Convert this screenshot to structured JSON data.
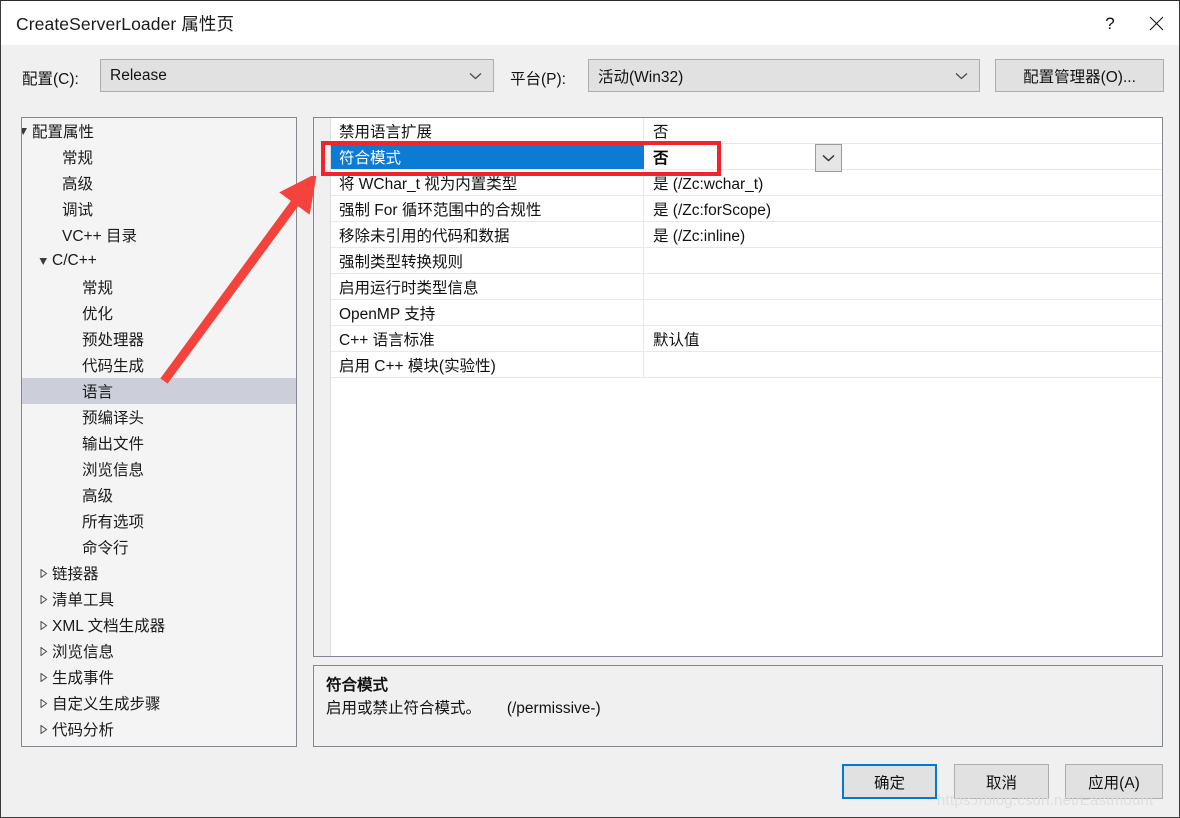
{
  "window": {
    "title": "CreateServerLoader 属性页",
    "help_icon": "?",
    "close_icon": "close-icon"
  },
  "config_bar": {
    "configuration_label": "配置(C):",
    "configuration_value": "Release",
    "platform_label": "平台(P):",
    "platform_value": "活动(Win32)",
    "config_manager_button": "配置管理器(O)..."
  },
  "tree": {
    "items": [
      {
        "label": "配置属性",
        "indent": 10,
        "twisty": "expanded",
        "selected": false
      },
      {
        "label": "常规",
        "indent": 40,
        "twisty": "none",
        "selected": false
      },
      {
        "label": "高级",
        "indent": 40,
        "twisty": "none",
        "selected": false
      },
      {
        "label": "调试",
        "indent": 40,
        "twisty": "none",
        "selected": false
      },
      {
        "label": "VC++ 目录",
        "indent": 40,
        "twisty": "none",
        "selected": false
      },
      {
        "label": "C/C++",
        "indent": 30,
        "twisty": "expanded",
        "selected": false
      },
      {
        "label": "常规",
        "indent": 60,
        "twisty": "none",
        "selected": false
      },
      {
        "label": "优化",
        "indent": 60,
        "twisty": "none",
        "selected": false
      },
      {
        "label": "预处理器",
        "indent": 60,
        "twisty": "none",
        "selected": false
      },
      {
        "label": "代码生成",
        "indent": 60,
        "twisty": "none",
        "selected": false
      },
      {
        "label": "语言",
        "indent": 60,
        "twisty": "none",
        "selected": true
      },
      {
        "label": "预编译头",
        "indent": 60,
        "twisty": "none",
        "selected": false
      },
      {
        "label": "输出文件",
        "indent": 60,
        "twisty": "none",
        "selected": false
      },
      {
        "label": "浏览信息",
        "indent": 60,
        "twisty": "none",
        "selected": false
      },
      {
        "label": "高级",
        "indent": 60,
        "twisty": "none",
        "selected": false
      },
      {
        "label": "所有选项",
        "indent": 60,
        "twisty": "none",
        "selected": false
      },
      {
        "label": "命令行",
        "indent": 60,
        "twisty": "none",
        "selected": false
      },
      {
        "label": "链接器",
        "indent": 30,
        "twisty": "collapsed",
        "selected": false
      },
      {
        "label": "清单工具",
        "indent": 30,
        "twisty": "collapsed",
        "selected": false
      },
      {
        "label": "XML 文档生成器",
        "indent": 30,
        "twisty": "collapsed",
        "selected": false
      },
      {
        "label": "浏览信息",
        "indent": 30,
        "twisty": "collapsed",
        "selected": false
      },
      {
        "label": "生成事件",
        "indent": 30,
        "twisty": "collapsed",
        "selected": false
      },
      {
        "label": "自定义生成步骤",
        "indent": 30,
        "twisty": "collapsed",
        "selected": false
      },
      {
        "label": "代码分析",
        "indent": 30,
        "twisty": "collapsed",
        "selected": false
      }
    ]
  },
  "grid": {
    "rows": [
      {
        "name": "禁用语言扩展",
        "value": "否",
        "selected": false
      },
      {
        "name": "符合模式",
        "value": "否",
        "selected": true
      },
      {
        "name": "将 WChar_t 视为内置类型",
        "value": "是 (/Zc:wchar_t)",
        "selected": false
      },
      {
        "name": "强制 For 循环范围中的合规性",
        "value": "是 (/Zc:forScope)",
        "selected": false
      },
      {
        "name": "移除未引用的代码和数据",
        "value": "是 (/Zc:inline)",
        "selected": false
      },
      {
        "name": "强制类型转换规则",
        "value": "",
        "selected": false
      },
      {
        "name": "启用运行时类型信息",
        "value": "",
        "selected": false
      },
      {
        "name": "OpenMP 支持",
        "value": "",
        "selected": false
      },
      {
        "name": "C++ 语言标准",
        "value": "默认值",
        "selected": false
      },
      {
        "name": "启用 C++ 模块(实验性)",
        "value": "",
        "selected": false
      }
    ],
    "dropdown_icon": "chevron-down-icon"
  },
  "description": {
    "title": "符合模式",
    "text": "启用或禁止符合模式。      (/permissive-)"
  },
  "buttons": {
    "ok": "确定",
    "cancel": "取消",
    "apply": "应用(A)"
  },
  "annotations": {
    "highlight_color": "#f4232b",
    "arrow_color": "#f4433c"
  },
  "watermark": {
    "text": "https://blog.csdn.net/Eastmount"
  },
  "colors": {
    "dialog_bg": "#f0f0f0",
    "titlebar_bg": "#ffffff",
    "grid_selection_blue": "#0c7bd4",
    "tree_selection": "#ccced9",
    "focus_blue": "#0078d7"
  }
}
